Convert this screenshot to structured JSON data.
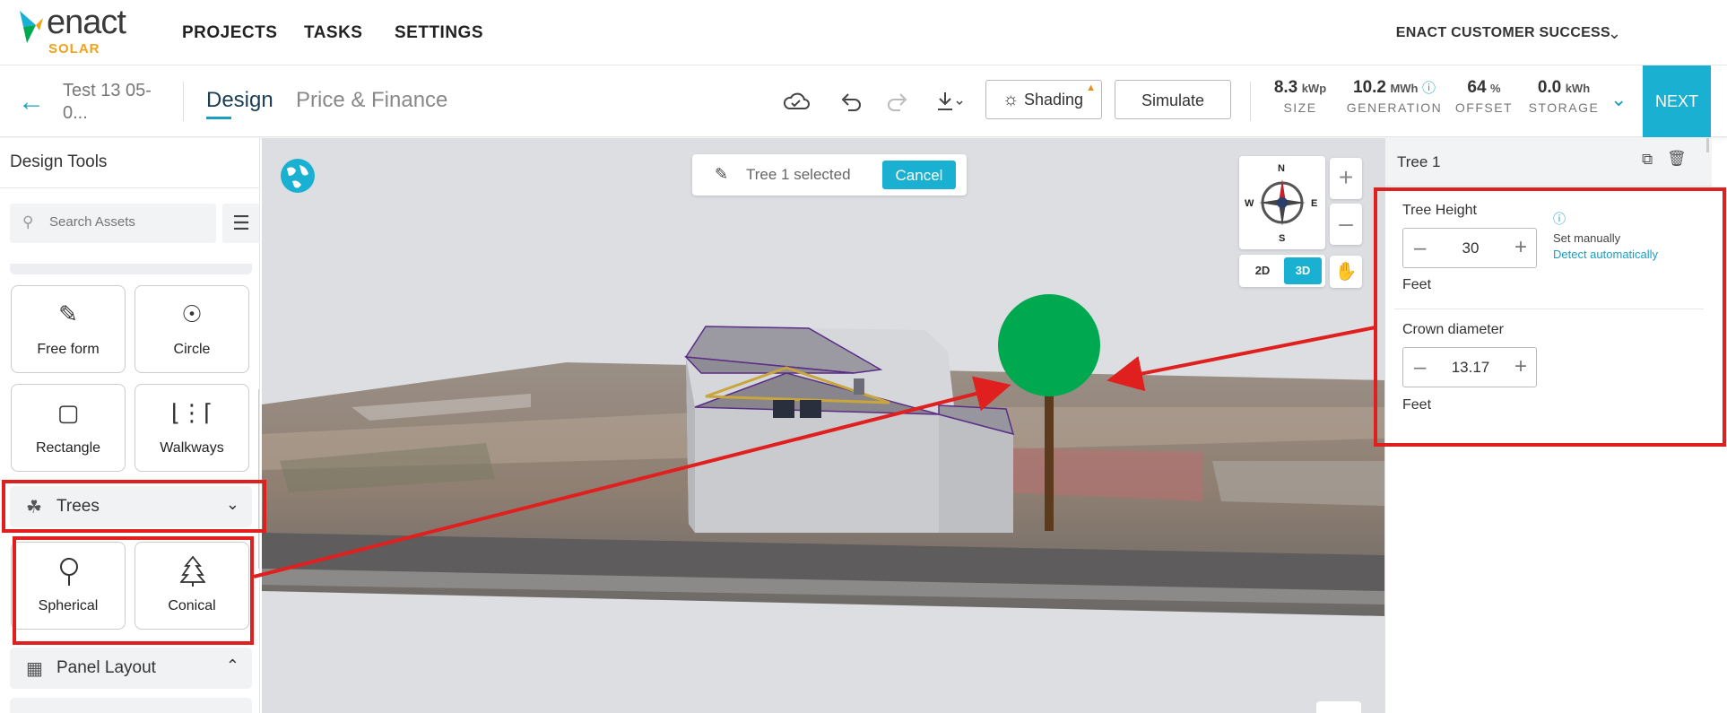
{
  "brand": {
    "name": "enact",
    "sub": "SOLAR"
  },
  "topnav": {
    "links": [
      "PROJECTS",
      "TASKS",
      "SETTINGS"
    ],
    "account": "ENACT CUSTOMER SUCCESS"
  },
  "toolbar": {
    "project_name": "Test 13 05-0...",
    "tabs": {
      "design": "Design",
      "price": "Price & Finance"
    },
    "shading_label": "Shading",
    "simulate_label": "Simulate",
    "stats": [
      {
        "value": "8.3",
        "unit": "kWp",
        "label": "SIZE"
      },
      {
        "value": "10.2",
        "unit": "MWh",
        "label": "GENERATION"
      },
      {
        "value": "64",
        "unit": "%",
        "label": "OFFSET"
      },
      {
        "value": "0.0",
        "unit": "kWh",
        "label": "STORAGE"
      }
    ],
    "next_label": "NEXT"
  },
  "sidebar": {
    "title": "Design Tools",
    "search_placeholder": "Search Assets",
    "tools": [
      {
        "label": "Free form",
        "icon": "pen-tool-icon"
      },
      {
        "label": "Circle",
        "icon": "circle-icon"
      },
      {
        "label": "Rectangle",
        "icon": "rectangle-icon"
      },
      {
        "label": "Walkways",
        "icon": "walkways-icon"
      }
    ],
    "trees_section": "Trees",
    "tree_tools": [
      {
        "label": "Spherical",
        "icon": "spherical-tree-icon"
      },
      {
        "label": "Conical",
        "icon": "conical-tree-icon"
      }
    ],
    "panel_section": "Panel Layout"
  },
  "canvas": {
    "selection_text": "Tree 1 selected",
    "cancel_label": "Cancel",
    "compass": {
      "n": "N",
      "s": "S",
      "e": "E",
      "w": "W"
    },
    "view_2d": "2D",
    "view_3d": "3D",
    "active_view": "3D"
  },
  "panel": {
    "title": "Tree 1",
    "tree_height": {
      "label": "Tree Height",
      "value": "30",
      "unit": "Feet"
    },
    "set_manually": "Set manually",
    "detect_auto": "Detect automatically",
    "crown_diameter": {
      "label": "Crown diameter",
      "value": "13.17",
      "unit": "Feet"
    }
  },
  "colors": {
    "accent": "#1ab0d1",
    "annotation": "#e0201f",
    "tree_crown": "#00a94f",
    "tree_trunk": "#5b3a1e",
    "brand_orange": "#f0a21b"
  }
}
